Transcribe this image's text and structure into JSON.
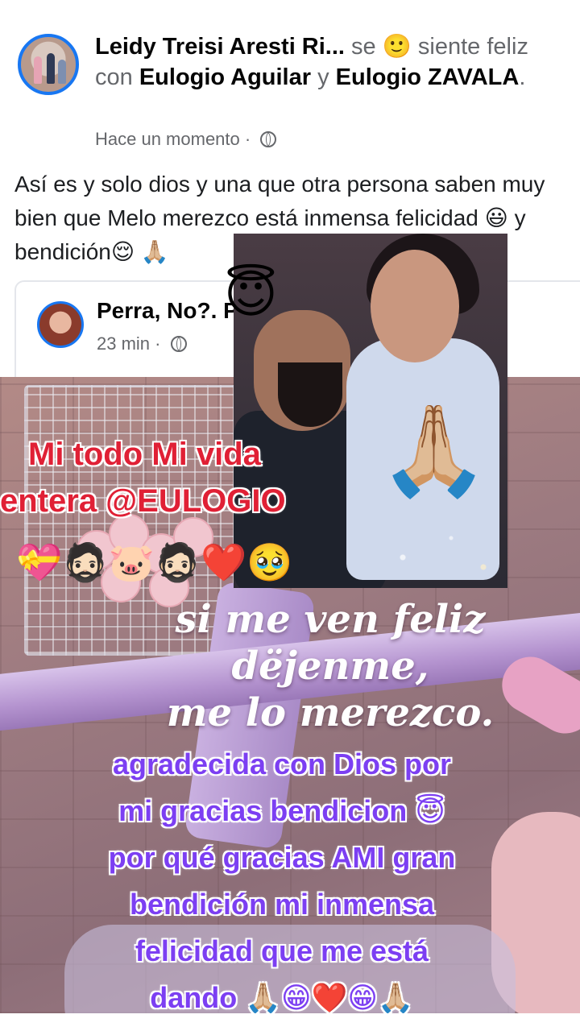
{
  "post": {
    "author": "Leidy Treisi Aresti Ri...",
    "feeling_prefix": "se",
    "feeling_emoji": "🙂",
    "feeling_text": "siente",
    "feeling_word": "feliz con",
    "tag1": "Eulogio Aguilar",
    "connector": "y",
    "tag2": "Eulogio ZAVALA",
    "period": ".",
    "time": "Hace un momento",
    "separator": "·",
    "audience_icon": "globe-icon",
    "text": "Así es y solo dios y una que otra persona saben muy bien  que Melo merezco está inmensa felicidad 😃 y bendición😌 🙏🏼"
  },
  "shared": {
    "name": "Perra, No?. Purisima.",
    "time": "23 min",
    "separator": "·",
    "audience_icon": "globe-icon"
  },
  "stickers": {
    "halo": "😇",
    "pray": "🙏🏼"
  },
  "overlay_red": {
    "line1": "Mi todo Mi vida",
    "line2": "entera @EULOGIO",
    "emojis": "💝🧔🏻🐷🧔🏻❤️🥹"
  },
  "script": {
    "line1": "si me ven feliz",
    "line2": "dëjenme,",
    "line3": "me lo merezco."
  },
  "overlay_purple": {
    "lines": [
      "agradecida con Dios por",
      "mi gracias bendicion 😇",
      "por qué gracias AMI gran",
      "bendición mi inmensa",
      "felicidad que me está",
      "dando 🙏🏼😁❤️😁🙏🏼"
    ]
  },
  "colors": {
    "accent": "#1877f2",
    "red_text": "#e02035",
    "purple_text": "#7c3ff2"
  }
}
